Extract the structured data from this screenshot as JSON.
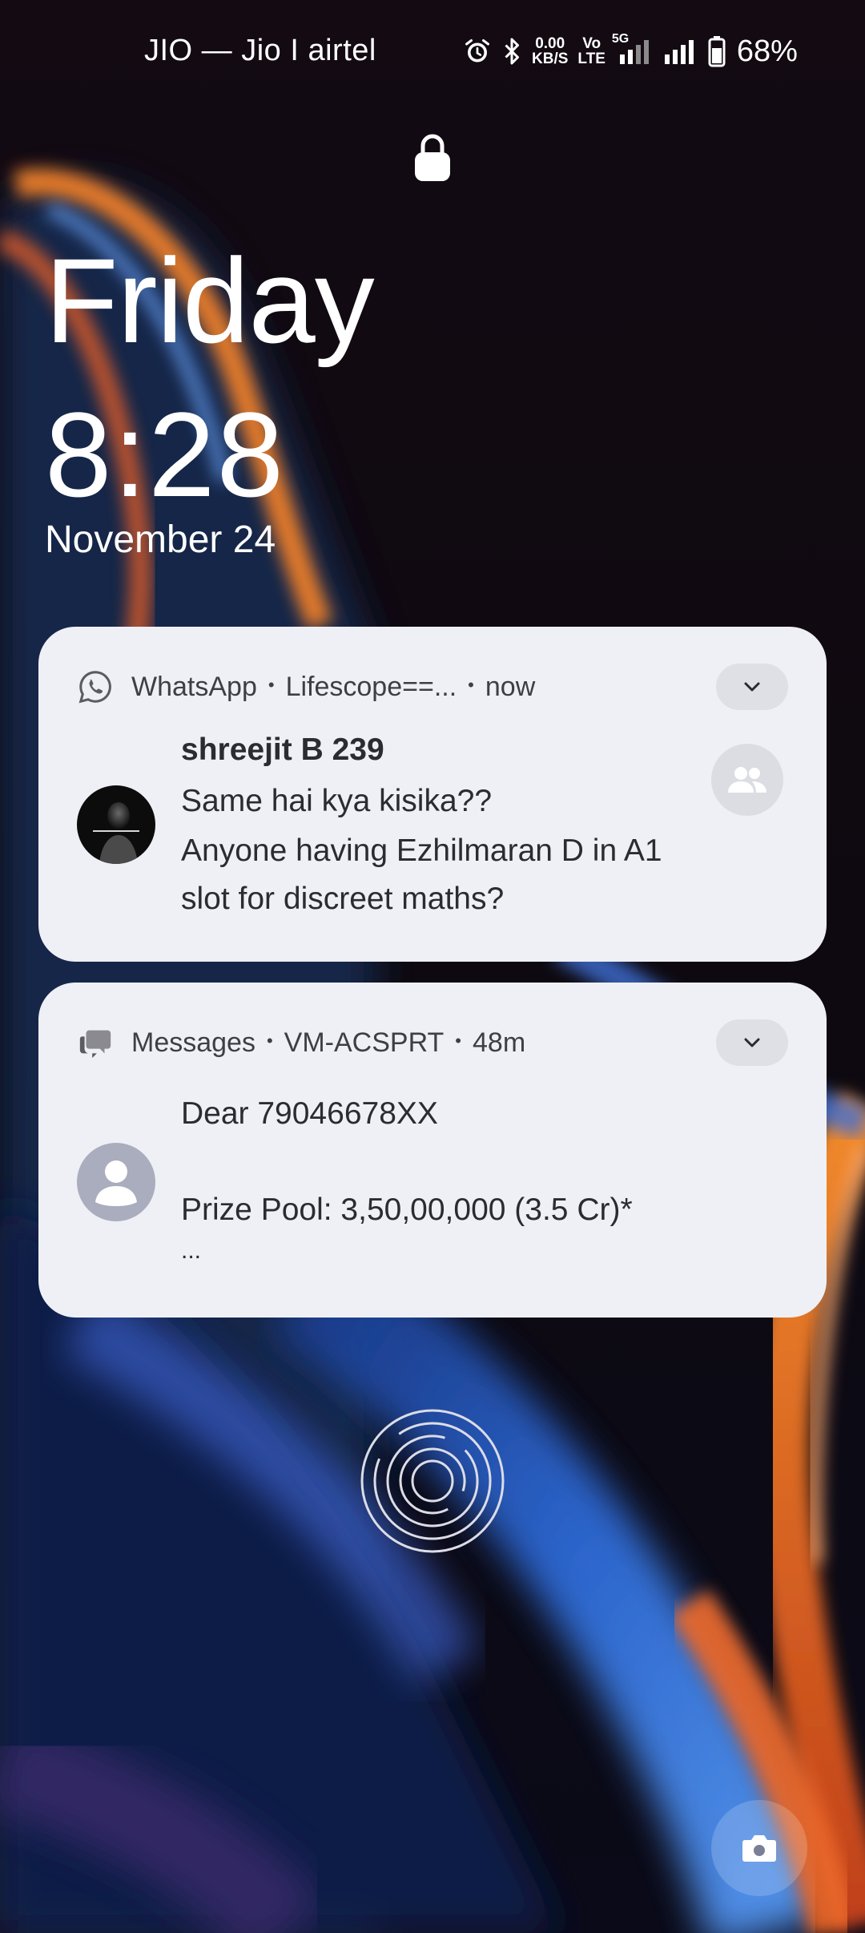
{
  "status_bar": {
    "carrier": "JIO — Jio I airtel",
    "net_speed_value": "0.00",
    "net_speed_unit": "KB/S",
    "volte_top": "Vo",
    "volte_bottom": "LTE",
    "net_type": "5G",
    "battery_percent": "68%"
  },
  "lock_screen": {
    "day": "Friday",
    "time": "8:28",
    "date": "November 24"
  },
  "notifications": [
    {
      "app": "WhatsApp",
      "group": "Lifescope==...",
      "time": "now",
      "title": "shreejit B 239",
      "lines": [
        "Same hai kya kisika??",
        "Anyone having Ezhilmaran D in A1",
        "slot for discreet maths?"
      ]
    },
    {
      "app": "Messages",
      "sender": "VM-ACSPRT",
      "time": "48m",
      "lines": [
        "Dear 79046678XX",
        "Prize Pool: 3,50,00,000 (3.5 Cr)*",
        "..."
      ]
    }
  ],
  "colors": {
    "card_bg": "#eff0f5",
    "text_dark": "#2a2a2e",
    "wallpaper_orange": "#f06a2b",
    "wallpaper_blue": "#2f6fe0"
  },
  "icons": [
    "alarm-icon",
    "bluetooth-icon",
    "signal-icon",
    "battery-icon",
    "lock-icon",
    "whatsapp-icon",
    "messages-icon",
    "chevron-down-icon",
    "group-icon",
    "person-icon",
    "fingerprint-icon",
    "camera-icon"
  ]
}
